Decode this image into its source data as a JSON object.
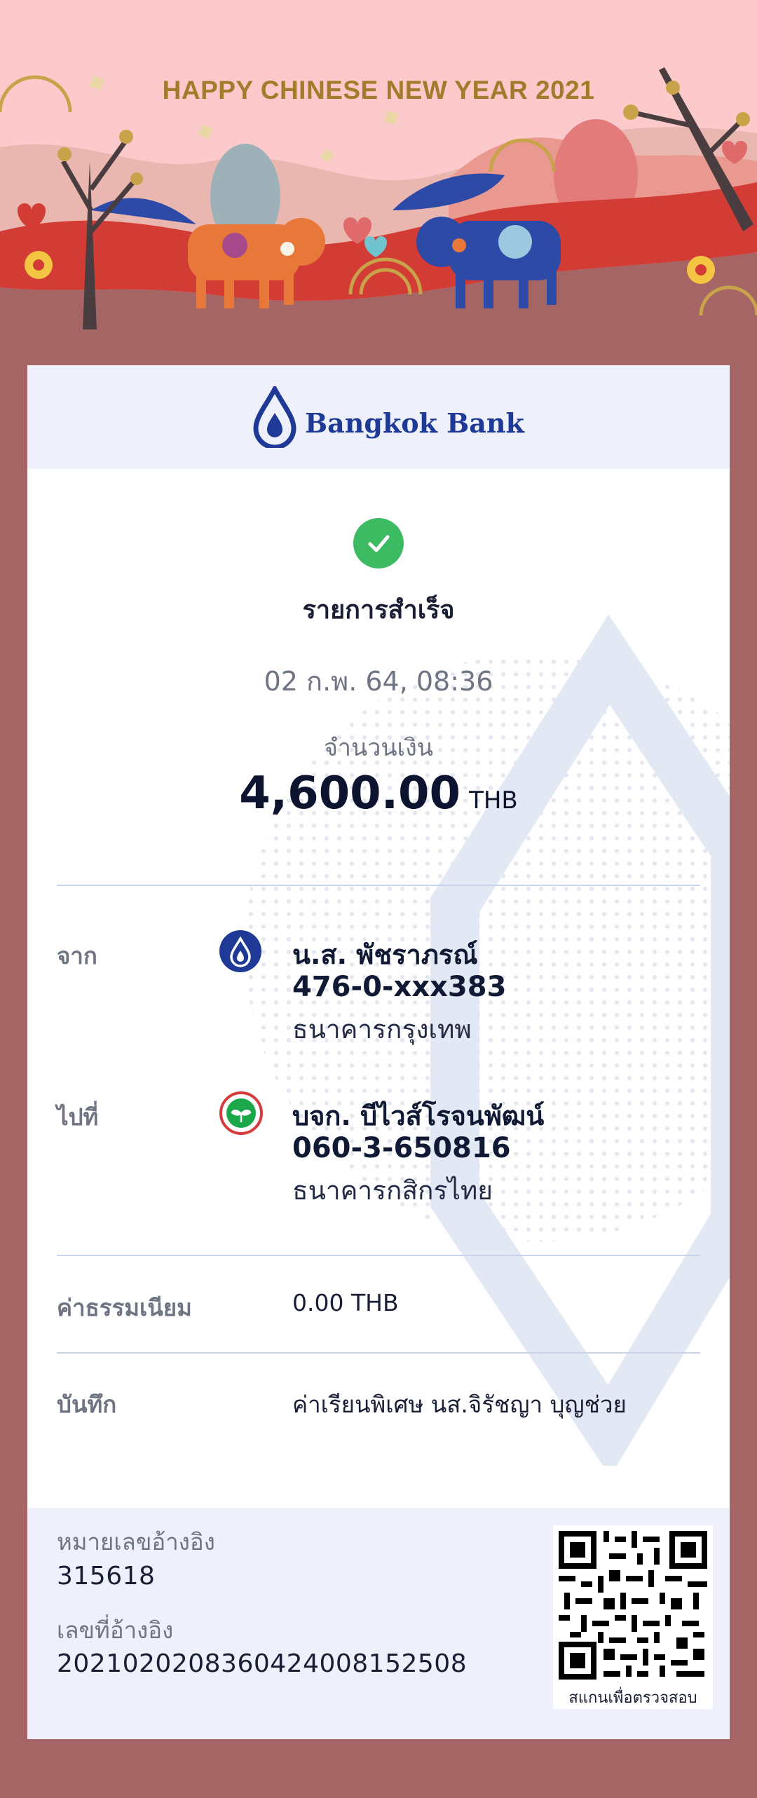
{
  "banner": {
    "title": "HAPPY CHINESE NEW YEAR 2021"
  },
  "bank": {
    "name": "Bangkok Bank"
  },
  "receipt": {
    "status": "รายการสำเร็จ",
    "datetime": "02 ก.พ. 64, 08:36",
    "amount_label": "จำนวนเงิน",
    "amount": "4,600.00",
    "currency": "THB",
    "from": {
      "label": "จาก",
      "name": "น.ส. พัชราภรณ์",
      "account": "476-0-xxx383",
      "bank": "ธนาคารกรุงเทพ",
      "icon": "bangkok-bank-icon"
    },
    "to": {
      "label": "ไปที่",
      "name": "บจก. บีไวส์โรจนพัฒน์",
      "account": "060-3-650816",
      "bank": "ธนาคารกสิกรไทย",
      "icon": "kasikorn-bank-icon"
    },
    "fee": {
      "label": "ค่าธรรมเนียม",
      "value": "0.00 THB"
    },
    "memo": {
      "label": "บันทึก",
      "value": "ค่าเรียนพิเศษ นส.จิรัชญา บุญช่วย"
    }
  },
  "footer": {
    "ref1_label": "หมายเลขอ้างอิง",
    "ref1_value": "315618",
    "ref2_label": "เลขที่อ้างอิง",
    "ref2_value": "2021020208360424008152508",
    "qr_caption": "สแกนเพื่อตรวจสอบ"
  },
  "colors": {
    "background": "#a56565",
    "banner_sky": "#fccaca",
    "banner_title": "#a47a2c",
    "brand_blue": "#1e3a96",
    "success_green": "#3dbb63",
    "kasikorn_green": "#1ba84b"
  }
}
